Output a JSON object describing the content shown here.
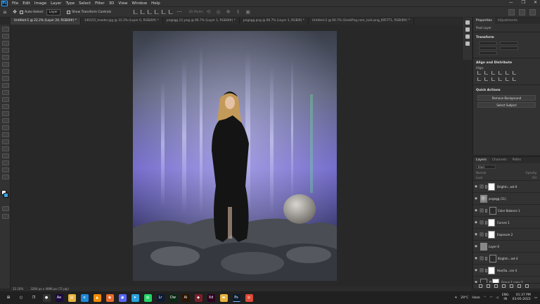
{
  "menubar": {
    "logo": "Ps",
    "items": [
      "File",
      "Edit",
      "Image",
      "Layer",
      "Type",
      "Select",
      "Filter",
      "3D",
      "View",
      "Window",
      "Help"
    ],
    "window_controls": [
      "—",
      "❐",
      "✕"
    ]
  },
  "options": {
    "auto_select_label": "Auto-Select:",
    "auto_select_value": "Layer",
    "transform_label": "Show Transform Controls",
    "mode_label": "3D Mode:"
  },
  "tabs": [
    {
      "label": "Untitled-1 @ 22.2% (Layer 24, RGB/8#) *",
      "active": true
    },
    {
      "label": "140155_header.jpg @ 33.3% (Layer 0, RGB/8#) *",
      "active": false
    },
    {
      "label": "pngegg (1).png @ 66.7% (Layer 1, RGB/8#) *",
      "active": false
    },
    {
      "label": "pngegg.png @ 66.7% (Layer 1, RGB/8) *",
      "active": false
    },
    {
      "label": "Untitled-2 @ 66.7% (GeekPng.com_rock-png_6957T1, RGB/8#) *",
      "active": false
    }
  ],
  "status": {
    "zoom": "22.16%",
    "doc_size": "3264 px x 4896 px (72 ppi)"
  },
  "properties": {
    "tab_properties": "Properties",
    "tab_adjustments": "Adjustments",
    "layer_type": "Pixel Layer",
    "transform_title": "Transform",
    "align_title": "Align and Distribute",
    "align_label": "Align:",
    "quick_actions_title": "Quick Actions",
    "remove_bg": "Remove Background",
    "select_subject": "Select Subject"
  },
  "layers_panel": {
    "tab_layers": "Layers",
    "tab_channels": "Channels",
    "tab_paths": "Paths",
    "filter_kind": "Kind",
    "blend_mode": "Normal",
    "opacity_label": "Opacity:",
    "lock_label": "Lock:",
    "fill_label": "Fill:",
    "rows": [
      {
        "name": "Brightn...ast 6",
        "thumb": "white",
        "mask": true
      },
      {
        "name": "pngegg (11)",
        "thumb": "rock",
        "mask": false
      },
      {
        "name": "Color Balance 1",
        "thumb": "white",
        "mask": true
      },
      {
        "name": "Curves 1",
        "thumb": "white",
        "mask": true
      },
      {
        "name": "Exposure 2",
        "thumb": "white",
        "mask": true
      },
      {
        "name": "Layer 6",
        "thumb": "dark",
        "mask": false
      },
      {
        "name": "Brightn...ast 4",
        "thumb": "white",
        "mask": true
      },
      {
        "name": "Hue/Sa...ion 4",
        "thumb": "white",
        "mask": true
      },
      {
        "name": "Group 1 copy 2",
        "thumb": "white",
        "mask": true
      }
    ]
  },
  "taskbar": {
    "weather_temp": "29°C",
    "weather_desc": "Haze",
    "lang": "ENG",
    "region": "IN",
    "time": "01:37 PM",
    "date": "03-05-2022",
    "apps": [
      {
        "name": "windows",
        "color": "#202020",
        "glyph": "⊞"
      },
      {
        "name": "search",
        "color": "#202020",
        "glyph": "○"
      },
      {
        "name": "task-view",
        "color": "#202020",
        "glyph": "❐"
      },
      {
        "name": "obs",
        "color": "#333333",
        "glyph": "●"
      },
      {
        "name": "after-effects",
        "color": "#1a0b3d",
        "glyph": "Ae"
      },
      {
        "name": "file-explorer",
        "color": "#e9b23c",
        "glyph": "▤"
      },
      {
        "name": "edge",
        "color": "#1e88d9",
        "glyph": "e"
      },
      {
        "name": "vlc",
        "color": "#f08a00",
        "glyph": "▲"
      },
      {
        "name": "firefox",
        "color": "#e8692b",
        "glyph": "◉"
      },
      {
        "name": "discord",
        "color": "#5865f2",
        "glyph": "◕"
      },
      {
        "name": "telegram",
        "color": "#2aa2dd",
        "glyph": "➤"
      },
      {
        "name": "whatsapp",
        "color": "#25d366",
        "glyph": "◍"
      },
      {
        "name": "lightroom",
        "color": "#0b1b34",
        "glyph": "Lr"
      },
      {
        "name": "dreamweaver",
        "color": "#0b2a14",
        "glyph": "Dw"
      },
      {
        "name": "illustrator",
        "color": "#2d1600",
        "glyph": "Ai"
      },
      {
        "name": "unknown",
        "color": "#7a1f2a",
        "glyph": "◆"
      },
      {
        "name": "xd",
        "color": "#2e001f",
        "glyph": "Xd"
      },
      {
        "name": "folder",
        "color": "#e9b23c",
        "glyph": "▬"
      },
      {
        "name": "photoshop",
        "color": "#0a1b2e",
        "glyph": "Ps"
      },
      {
        "name": "chrome",
        "color": "#dd4b39",
        "glyph": "◎"
      }
    ]
  }
}
